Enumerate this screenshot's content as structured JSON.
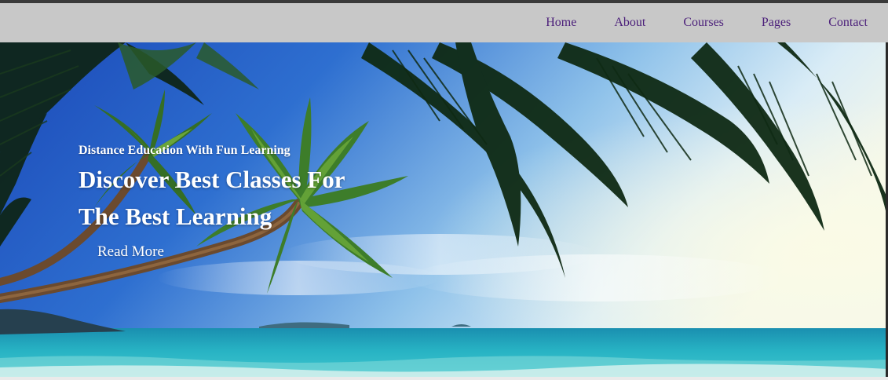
{
  "nav": {
    "items": [
      {
        "label": "Home"
      },
      {
        "label": "About"
      },
      {
        "label": "Courses"
      },
      {
        "label": "Pages"
      },
      {
        "label": "Contact"
      }
    ]
  },
  "hero": {
    "subtitle": "Distance Education With Fun Learning",
    "title_line1": "Discover Best Classes For",
    "title_line2": "The Best Learning",
    "cta_label": "Read More"
  },
  "colors": {
    "navbar_bg": "#c8c8c8",
    "nav_link": "#4b1f7a",
    "hero_text": "#ffffff",
    "sky": "#2a63c8",
    "sea": "#1fa8b8"
  }
}
